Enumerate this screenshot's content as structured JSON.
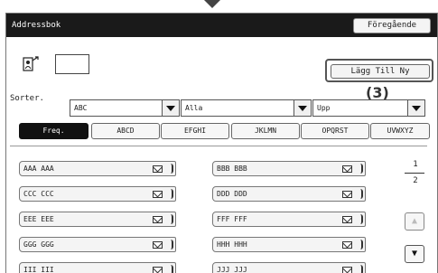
{
  "window": {
    "title": "Addressbok",
    "back_label": "Föregående"
  },
  "toolbar": {
    "add_label": "Lägg Till Ny",
    "callout": "(3)"
  },
  "sort": {
    "label": "Sorter.",
    "field_value": "ABC",
    "filter_value": "Alla",
    "order_value": "Upp"
  },
  "tabs": [
    "Freq.",
    "ABCD",
    "EFGHI",
    "JKLMN",
    "OPQRST",
    "UVWXYZ"
  ],
  "contacts": {
    "left": [
      "AAA AAA",
      "CCC CCC",
      "EEE EEE",
      "GGG GGG",
      "III III"
    ],
    "right": [
      "BBB BBB",
      "DDD DDD",
      "FFF FFF",
      "HHH HHH",
      "JJJ JJJ"
    ]
  },
  "pager": {
    "current": "1",
    "total": "2"
  },
  "icons": {
    "number_entry": "person-hash-icon",
    "mail": "envelope-icon",
    "dropdown": "chevron-down-icon",
    "scroll_up": "arrow-up-icon",
    "scroll_down": "arrow-down-icon"
  }
}
